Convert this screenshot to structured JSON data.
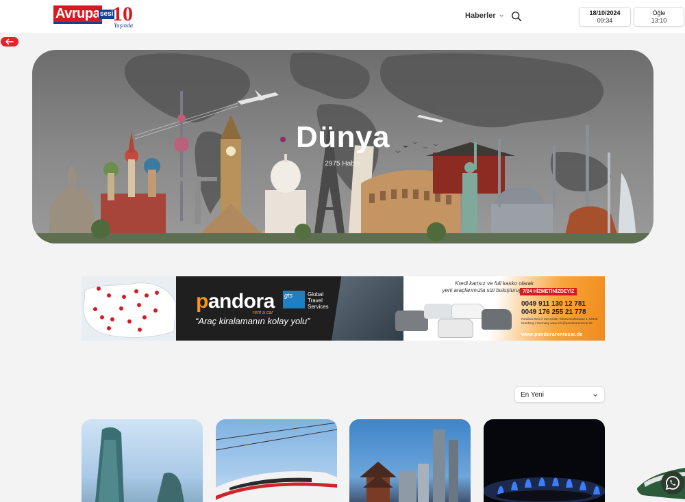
{
  "header": {
    "logo": {
      "brand": "Avrupa",
      "brand_suffix": "sesi",
      "anniversary_number": "10",
      "anniversary_word": "Yaşında"
    },
    "nav": {
      "news_label": "Haberler"
    },
    "date": {
      "date": "18/10/2024",
      "time": "09:34"
    },
    "prayer": {
      "name": "Öğle",
      "time": "13:10"
    }
  },
  "hero": {
    "title": "Dünya",
    "count": "2975 Haber"
  },
  "ad": {
    "brand": "andora",
    "brand_initial": "p",
    "brand_sub": "rent a car",
    "gts": "gts",
    "gts_line1": "Global",
    "gts_line2": "Travel",
    "gts_line3": "Services",
    "slogan": "“Araç kiralamanın kolay yolu”",
    "offer_line1": "Kredi kartsız ve full kasko olarak",
    "offer_line2": "yeni araçlarımızla sizi buluşturuyoruz.",
    "service": "7/24 HİZMETİNİZDEYİZ",
    "phone1": "0049 911 130 12 781",
    "phone2": "0049 176 255 21 778",
    "address": "Pandora Rent A Car GmbH Gibitzenhofstrasse 4, 90425 Nürnberg / Germany www.info@pandorarentacar.de",
    "website": "www.pandorarentacar.de"
  },
  "sort": {
    "selected": "En Yeni"
  },
  "colors": {
    "brand_red": "#d71920",
    "brand_blue": "#1b3f8f",
    "ad_orange": "#f7941d",
    "whatsapp_green": "#2b3b2e"
  }
}
